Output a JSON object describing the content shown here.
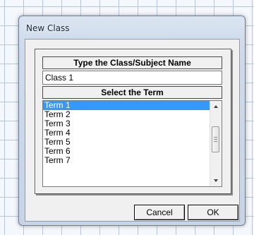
{
  "window": {
    "title": "New Class"
  },
  "form": {
    "name_header": "Type the Class/Subject Name",
    "name_value": "Class 1",
    "term_header": "Select the Term"
  },
  "terms": {
    "items": [
      "Term 1",
      "Term 2",
      "Term 3",
      "Term 4",
      "Term 5",
      "Term 6",
      "Term 7"
    ],
    "selected": "Term 1"
  },
  "buttons": {
    "cancel_label": "Cancel",
    "ok_label": "OK"
  },
  "colors": {
    "selection": "#3399ff",
    "window_frame": "#cfdbea"
  },
  "icons": {
    "scroll_up": "scroll-up-arrow-icon",
    "scroll_down": "scroll-down-arrow-icon"
  }
}
